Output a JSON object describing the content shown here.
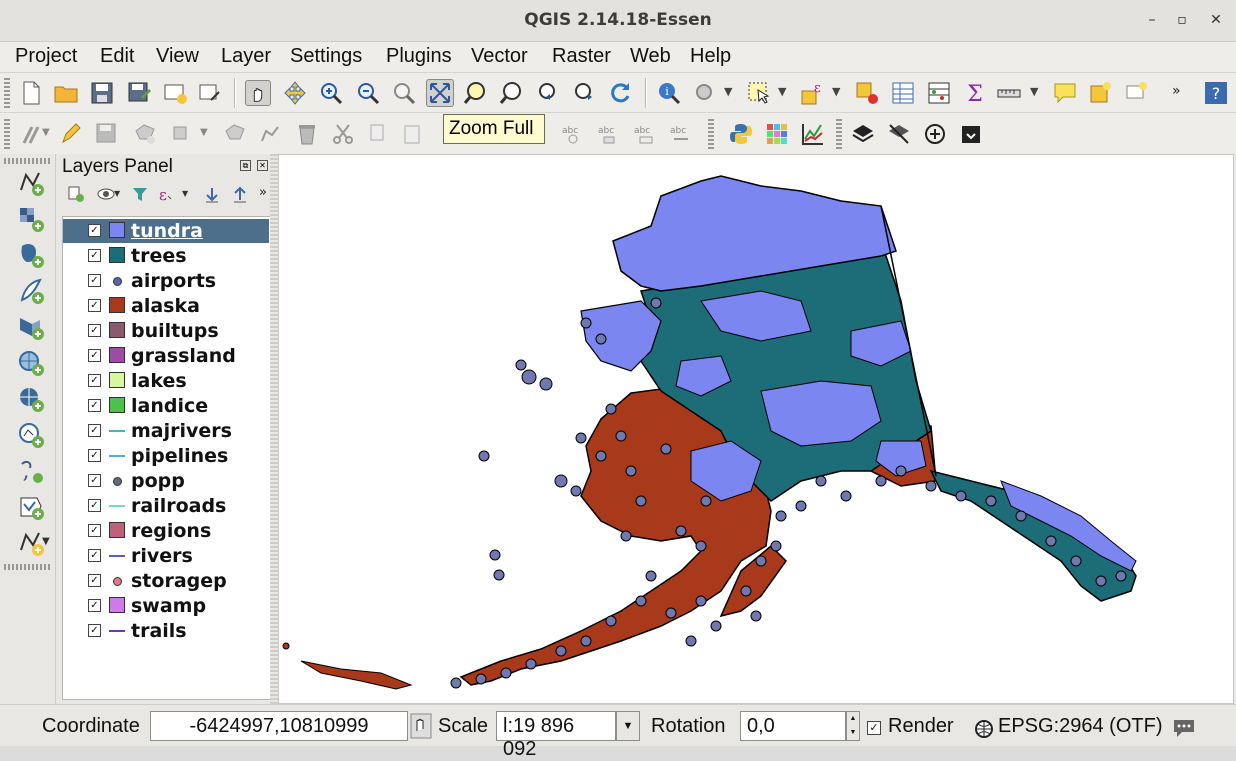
{
  "window": {
    "title": "QGIS 2.14.18-Essen"
  },
  "menu": [
    "Project",
    "Edit",
    "View",
    "Layer",
    "Settings",
    "Plugins",
    "Vector",
    "Raster",
    "Web",
    "Help"
  ],
  "tooltip": "Zoom Full",
  "layers_panel": {
    "title": "Layers Panel",
    "layers": [
      {
        "name": "tundra",
        "symbol": "fill",
        "color": "#7b86f0",
        "checked": true,
        "selected": true
      },
      {
        "name": "trees",
        "symbol": "fill",
        "color": "#1c6d78",
        "checked": true
      },
      {
        "name": "airports",
        "symbol": "point",
        "color": "#5a64a8",
        "checked": true
      },
      {
        "name": "alaska",
        "symbol": "fill",
        "color": "#a8391a",
        "checked": true
      },
      {
        "name": "builtups",
        "symbol": "fill",
        "color": "#8a5a6e",
        "checked": true
      },
      {
        "name": "grassland",
        "symbol": "fill",
        "color": "#a04aa8",
        "checked": true
      },
      {
        "name": "lakes",
        "symbol": "fill",
        "color": "#d8f5a0",
        "checked": true
      },
      {
        "name": "landice",
        "symbol": "fill",
        "color": "#4ec04e",
        "checked": true
      },
      {
        "name": "majrivers",
        "symbol": "line",
        "color": "#4ab0d0",
        "checked": true
      },
      {
        "name": "pipelines",
        "symbol": "line",
        "color": "#4ab0d0",
        "checked": true
      },
      {
        "name": "popp",
        "symbol": "point",
        "color": "#606a78",
        "checked": true
      },
      {
        "name": "railroads",
        "symbol": "line",
        "color": "#6adcc8",
        "checked": true
      },
      {
        "name": "regions",
        "symbol": "fill",
        "color": "#c0607a",
        "checked": true
      },
      {
        "name": "rivers",
        "symbol": "line",
        "color": "#5a5acd",
        "checked": true
      },
      {
        "name": "storagep",
        "symbol": "point",
        "color": "#e07a8a",
        "checked": true
      },
      {
        "name": "swamp",
        "symbol": "fill",
        "color": "#d07ae8",
        "checked": true
      },
      {
        "name": "trails",
        "symbol": "line",
        "color": "#6a3ab8",
        "checked": true
      }
    ]
  },
  "status": {
    "coordinate_label": "Coordinate",
    "coordinate_value": "-6424997,10810999",
    "scale_label": "Scale",
    "scale_value": "l:19 896 092",
    "rotation_label": "Rotation",
    "rotation_value": "0,0",
    "render_label": "Render",
    "crs": "EPSG:2964 (OTF)"
  },
  "colors": {
    "tundra": "#7b86f0",
    "trees": "#1c6d78",
    "alaska": "#a8391a",
    "points": "#6f79b0",
    "selection": "#4d6f8c"
  }
}
